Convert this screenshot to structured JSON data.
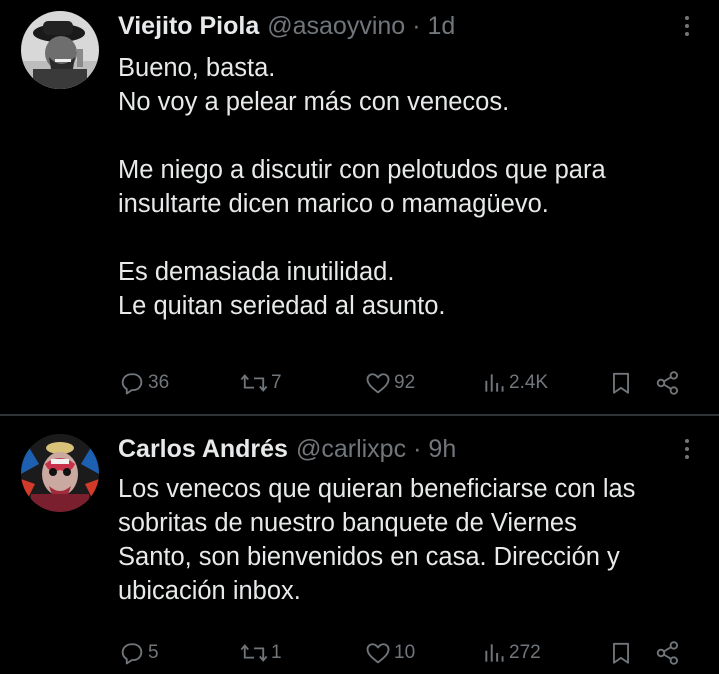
{
  "tweets": [
    {
      "display_name": "Viejito Piola",
      "handle": "@asaoyvino",
      "separator": "·",
      "time": "1d",
      "lines": [
        "Bueno, basta.",
        "No voy a pelear más con venecos.",
        "",
        "Me niego a discutir con pelotudos que para",
        "insultarte dicen marico o mamagüevo.",
        "",
        "Es demasiada inutilidad.",
        "Le quitan seriedad al asunto."
      ],
      "replies": "36",
      "reposts": "7",
      "likes": "92",
      "views": "2.4K"
    },
    {
      "display_name": "Carlos Andrés",
      "handle": "@carlixpc",
      "separator": "·",
      "time": "9h",
      "lines": [
        "Los venecos que quieran beneficiarse con las",
        "sobritas de nuestro banquete de Viernes",
        "Santo, son bienvenidos en casa. Dirección y",
        "ubicación inbox."
      ],
      "replies": "5",
      "reposts": "1",
      "likes": "10",
      "views": "272"
    }
  ],
  "icons": {
    "reply": "speech-bubble-icon",
    "repost": "repost-arrows-icon",
    "like": "heart-icon",
    "views": "bar-chart-icon",
    "bookmark": "bookmark-icon",
    "share": "share-icon",
    "more": "three-dots-vertical-icon"
  },
  "colors": {
    "background": "#000000",
    "text": "#e7e9ea",
    "secondary": "#71767b",
    "divider": "#2f3336"
  }
}
